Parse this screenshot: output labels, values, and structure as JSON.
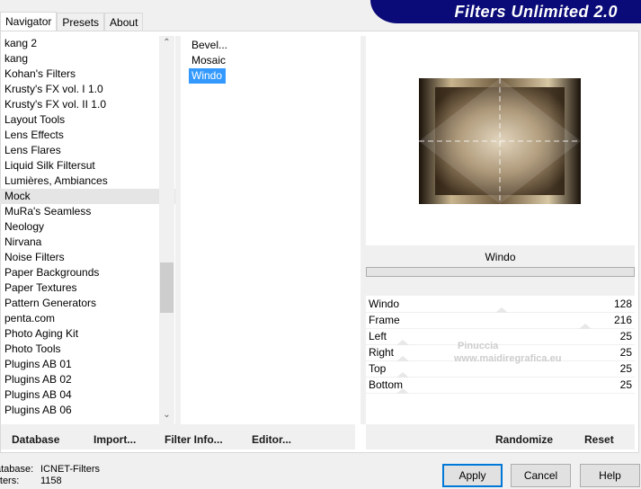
{
  "banner": {
    "title": "Filters Unlimited 2.0"
  },
  "tabs": [
    {
      "label": "Navigator",
      "active": true
    },
    {
      "label": "Presets"
    },
    {
      "label": "About"
    }
  ],
  "categories": {
    "items": [
      "kang 2",
      "kang",
      "Kohan's Filters",
      "Krusty's FX vol. I 1.0",
      "Krusty's FX vol. II 1.0",
      "Layout Tools",
      "Lens Effects",
      "Lens Flares",
      "Liquid Silk Filtersut",
      "Lumières, Ambiances",
      "Mock",
      "MuRa's Seamless",
      "Neology",
      "Nirvana",
      "Noise Filters",
      "Paper Backgrounds",
      "Paper Textures",
      "Pattern Generators",
      "penta.com",
      "Photo Aging Kit",
      "Photo Tools",
      "Plugins AB 01",
      "Plugins AB 02",
      "Plugins AB 04",
      "Plugins AB 06"
    ],
    "selected": "Mock"
  },
  "filters": {
    "items": [
      "Bevel...",
      "Mosaic",
      "Windo"
    ],
    "selected": "Windo"
  },
  "control": {
    "title": "Windo",
    "params": [
      {
        "label": "Windo",
        "value": 128
      },
      {
        "label": "Frame",
        "value": 216
      },
      {
        "label": "Left",
        "value": 25
      },
      {
        "label": "Right",
        "value": 25
      },
      {
        "label": "Top",
        "value": 25
      },
      {
        "label": "Bottom",
        "value": 25
      }
    ],
    "max": 255
  },
  "watermark": {
    "line1": "Pinuccia",
    "line2": "www.maidiregrafica.eu"
  },
  "buttons": {
    "database": "Database",
    "import": "Import...",
    "filter_info": "Filter Info...",
    "editor": "Editor...",
    "randomize": "Randomize",
    "reset": "Reset",
    "apply": "Apply",
    "cancel": "Cancel",
    "help": "Help"
  },
  "status": {
    "database_label": "atabase:",
    "database_value": "ICNET-Filters",
    "filters_label": "ilters:",
    "filters_value": "1158"
  },
  "colors": {
    "banner": "#0a0a78",
    "selection": "#3399ff",
    "default_button_border": "#0078d7"
  }
}
